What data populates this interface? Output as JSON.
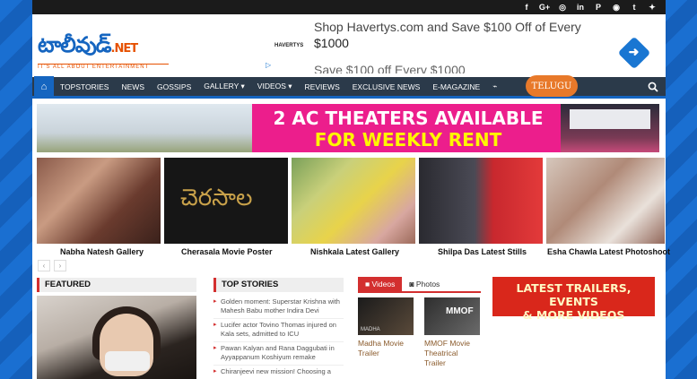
{
  "topbar": {
    "social": [
      {
        "icon": "facebook-icon",
        "glyph": "f"
      },
      {
        "icon": "google-plus-icon",
        "glyph": "G+"
      },
      {
        "icon": "instagram-icon",
        "glyph": "◎"
      },
      {
        "icon": "linkedin-icon",
        "glyph": "in"
      },
      {
        "icon": "pinterest-icon",
        "glyph": "P"
      },
      {
        "icon": "reddit-icon",
        "glyph": "◉"
      },
      {
        "icon": "tumblr-icon",
        "glyph": "t"
      },
      {
        "icon": "twitter-icon",
        "glyph": "✦"
      }
    ]
  },
  "logo": {
    "main": "టాలీవుడ్",
    "net": ".NET",
    "tagline": "IT'S ALL ABOUT ENTERTAINMENT"
  },
  "ad": {
    "brand": "HAVERTYS",
    "line1": "Shop Havertys.com and Save $100 Off of Every",
    "line2": "$1000",
    "line3": "Save $100 off Every $1000"
  },
  "nav": {
    "items": [
      "TOPSTORIES",
      "NEWS",
      "GOSSIPS",
      "GALLERY ▾",
      "VIDEOS ▾",
      "REVIEWS",
      "EXCLUSIVE NEWS",
      "E-MAGAZINE",
      "⌁"
    ],
    "telugu": "TELUGU"
  },
  "banner": {
    "line1": "2 AC THEATERS AVAILABLE",
    "line2": "FOR WEEKLY RENT"
  },
  "gallery": [
    {
      "caption": "Nabha Natesh Gallery"
    },
    {
      "caption": "Cherasala Movie Poster"
    },
    {
      "caption": "Nishkala Latest Gallery"
    },
    {
      "caption": "Shilpa Das Latest Stills"
    },
    {
      "caption": "Esha Chawla Latest Photoshoot"
    }
  ],
  "gallery_nav": {
    "prev": "‹",
    "next": "›"
  },
  "featured": {
    "heading": "FEATURED"
  },
  "topstories": {
    "heading": "TOP STORIES",
    "items": [
      "Golden moment: Superstar Krishna with Mahesh Babu mother Indira  Devi",
      "Lucifer actor Tovino Thomas injured on Kala sets, admitted to ICU",
      "Pawan Kalyan and Rana Daggubati in Ayyappanum Koshiyum remake",
      "Chiranjeevi new mission! Choosing a"
    ]
  },
  "media": {
    "tab_videos": "Videos",
    "tab_photos": "Photos",
    "videos": [
      {
        "caption": "Madha Movie Trailer",
        "thumb_text": "MADHA"
      },
      {
        "caption": "MMOF Movie Theatrical Trailer",
        "thumb_text": "MMOF"
      }
    ]
  },
  "promo": {
    "line1": "LATEST TRAILERS, EVENTS",
    "line2": "& MORE VIDEOS"
  },
  "colors": {
    "brand_blue": "#1565c0",
    "accent_red": "#d32f2f",
    "nav_dark": "#2b3a4a",
    "telugu_orange": "#e8792a"
  }
}
